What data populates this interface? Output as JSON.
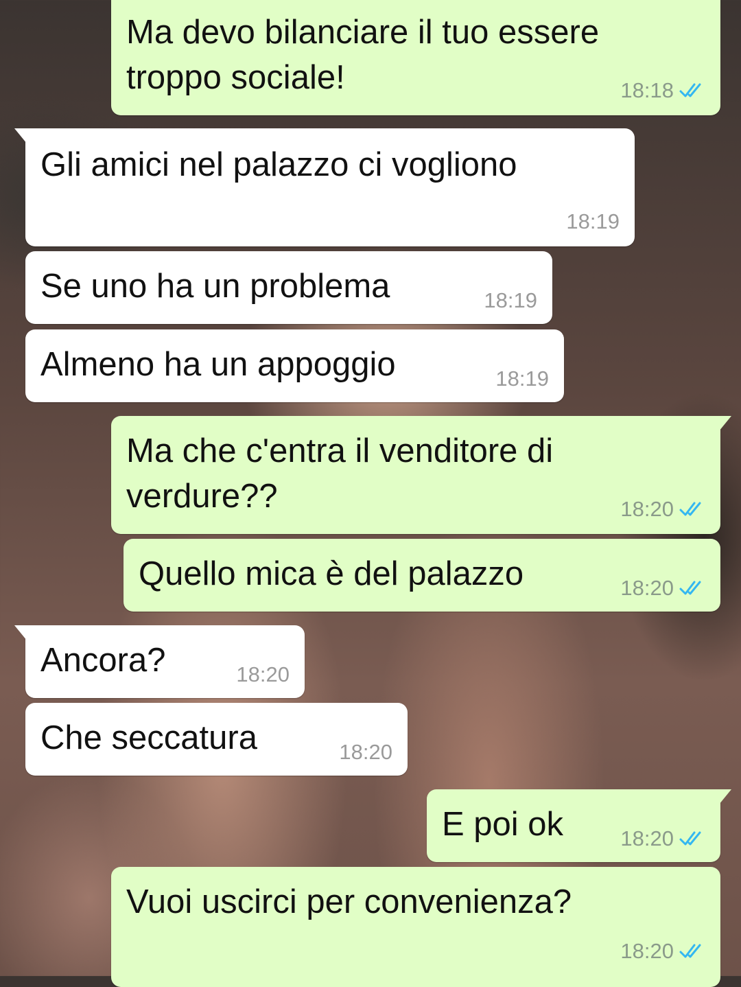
{
  "messages": [
    {
      "direction": "out",
      "text": "Ma devo bilanciare il tuo essere\ntroppo sociale!",
      "time": "18:18",
      "status": "read"
    },
    {
      "direction": "in",
      "text": "Gli amici nel palazzo ci vogliono",
      "time": "18:19"
    },
    {
      "direction": "in",
      "text": "Se uno ha un problema",
      "time": "18:19"
    },
    {
      "direction": "in",
      "text": "Almeno ha un appoggio",
      "time": "18:19"
    },
    {
      "direction": "out",
      "text": "Ma che c'entra il venditore di\nverdure??",
      "time": "18:20",
      "status": "read"
    },
    {
      "direction": "out",
      "text": "Quello mica è del palazzo",
      "time": "18:20",
      "status": "read"
    },
    {
      "direction": "in",
      "text": "Ancora?",
      "time": "18:20"
    },
    {
      "direction": "in",
      "text": "Che seccatura",
      "time": "18:20"
    },
    {
      "direction": "out",
      "text": "E poi ok",
      "time": "18:20",
      "status": "read"
    },
    {
      "direction": "out",
      "text": "Vuoi uscirci per convenienza?",
      "time": "18:20",
      "status": "read"
    }
  ],
  "colors": {
    "outgoing_bubble": "#e1fec6",
    "incoming_bubble": "#ffffff",
    "read_ticks": "#34b7f1"
  },
  "icons": {
    "read_status": "double-check-icon"
  }
}
